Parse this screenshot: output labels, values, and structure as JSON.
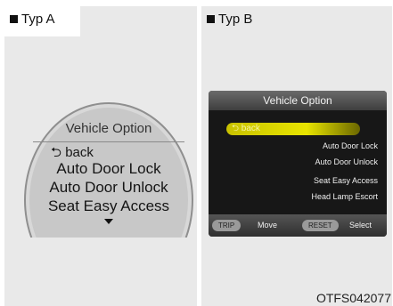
{
  "typ_a": {
    "title": "Typ A",
    "dial": {
      "header": "Vehicle Option",
      "back": "back",
      "items": [
        "Auto Door Lock",
        "Auto Door Unlock",
        "Seat Easy Access"
      ]
    }
  },
  "typ_b": {
    "title": "Typ B",
    "screen": {
      "header": "Vehicle Option",
      "back": "back",
      "items": [
        "Auto Door Lock",
        "Auto Door Unlock",
        "Seat Easy Access",
        "Head Lamp Escort"
      ],
      "footer": {
        "trip": "TRIP",
        "move": "Move",
        "reset": "RESET",
        "select": "Select"
      }
    }
  },
  "figure_code": "OTFS042077",
  "icons": {
    "square_bullet": "square-bullet-icon",
    "back_arrow": "return-arrow-icon",
    "scroll_down": "triangle-down-icon"
  }
}
